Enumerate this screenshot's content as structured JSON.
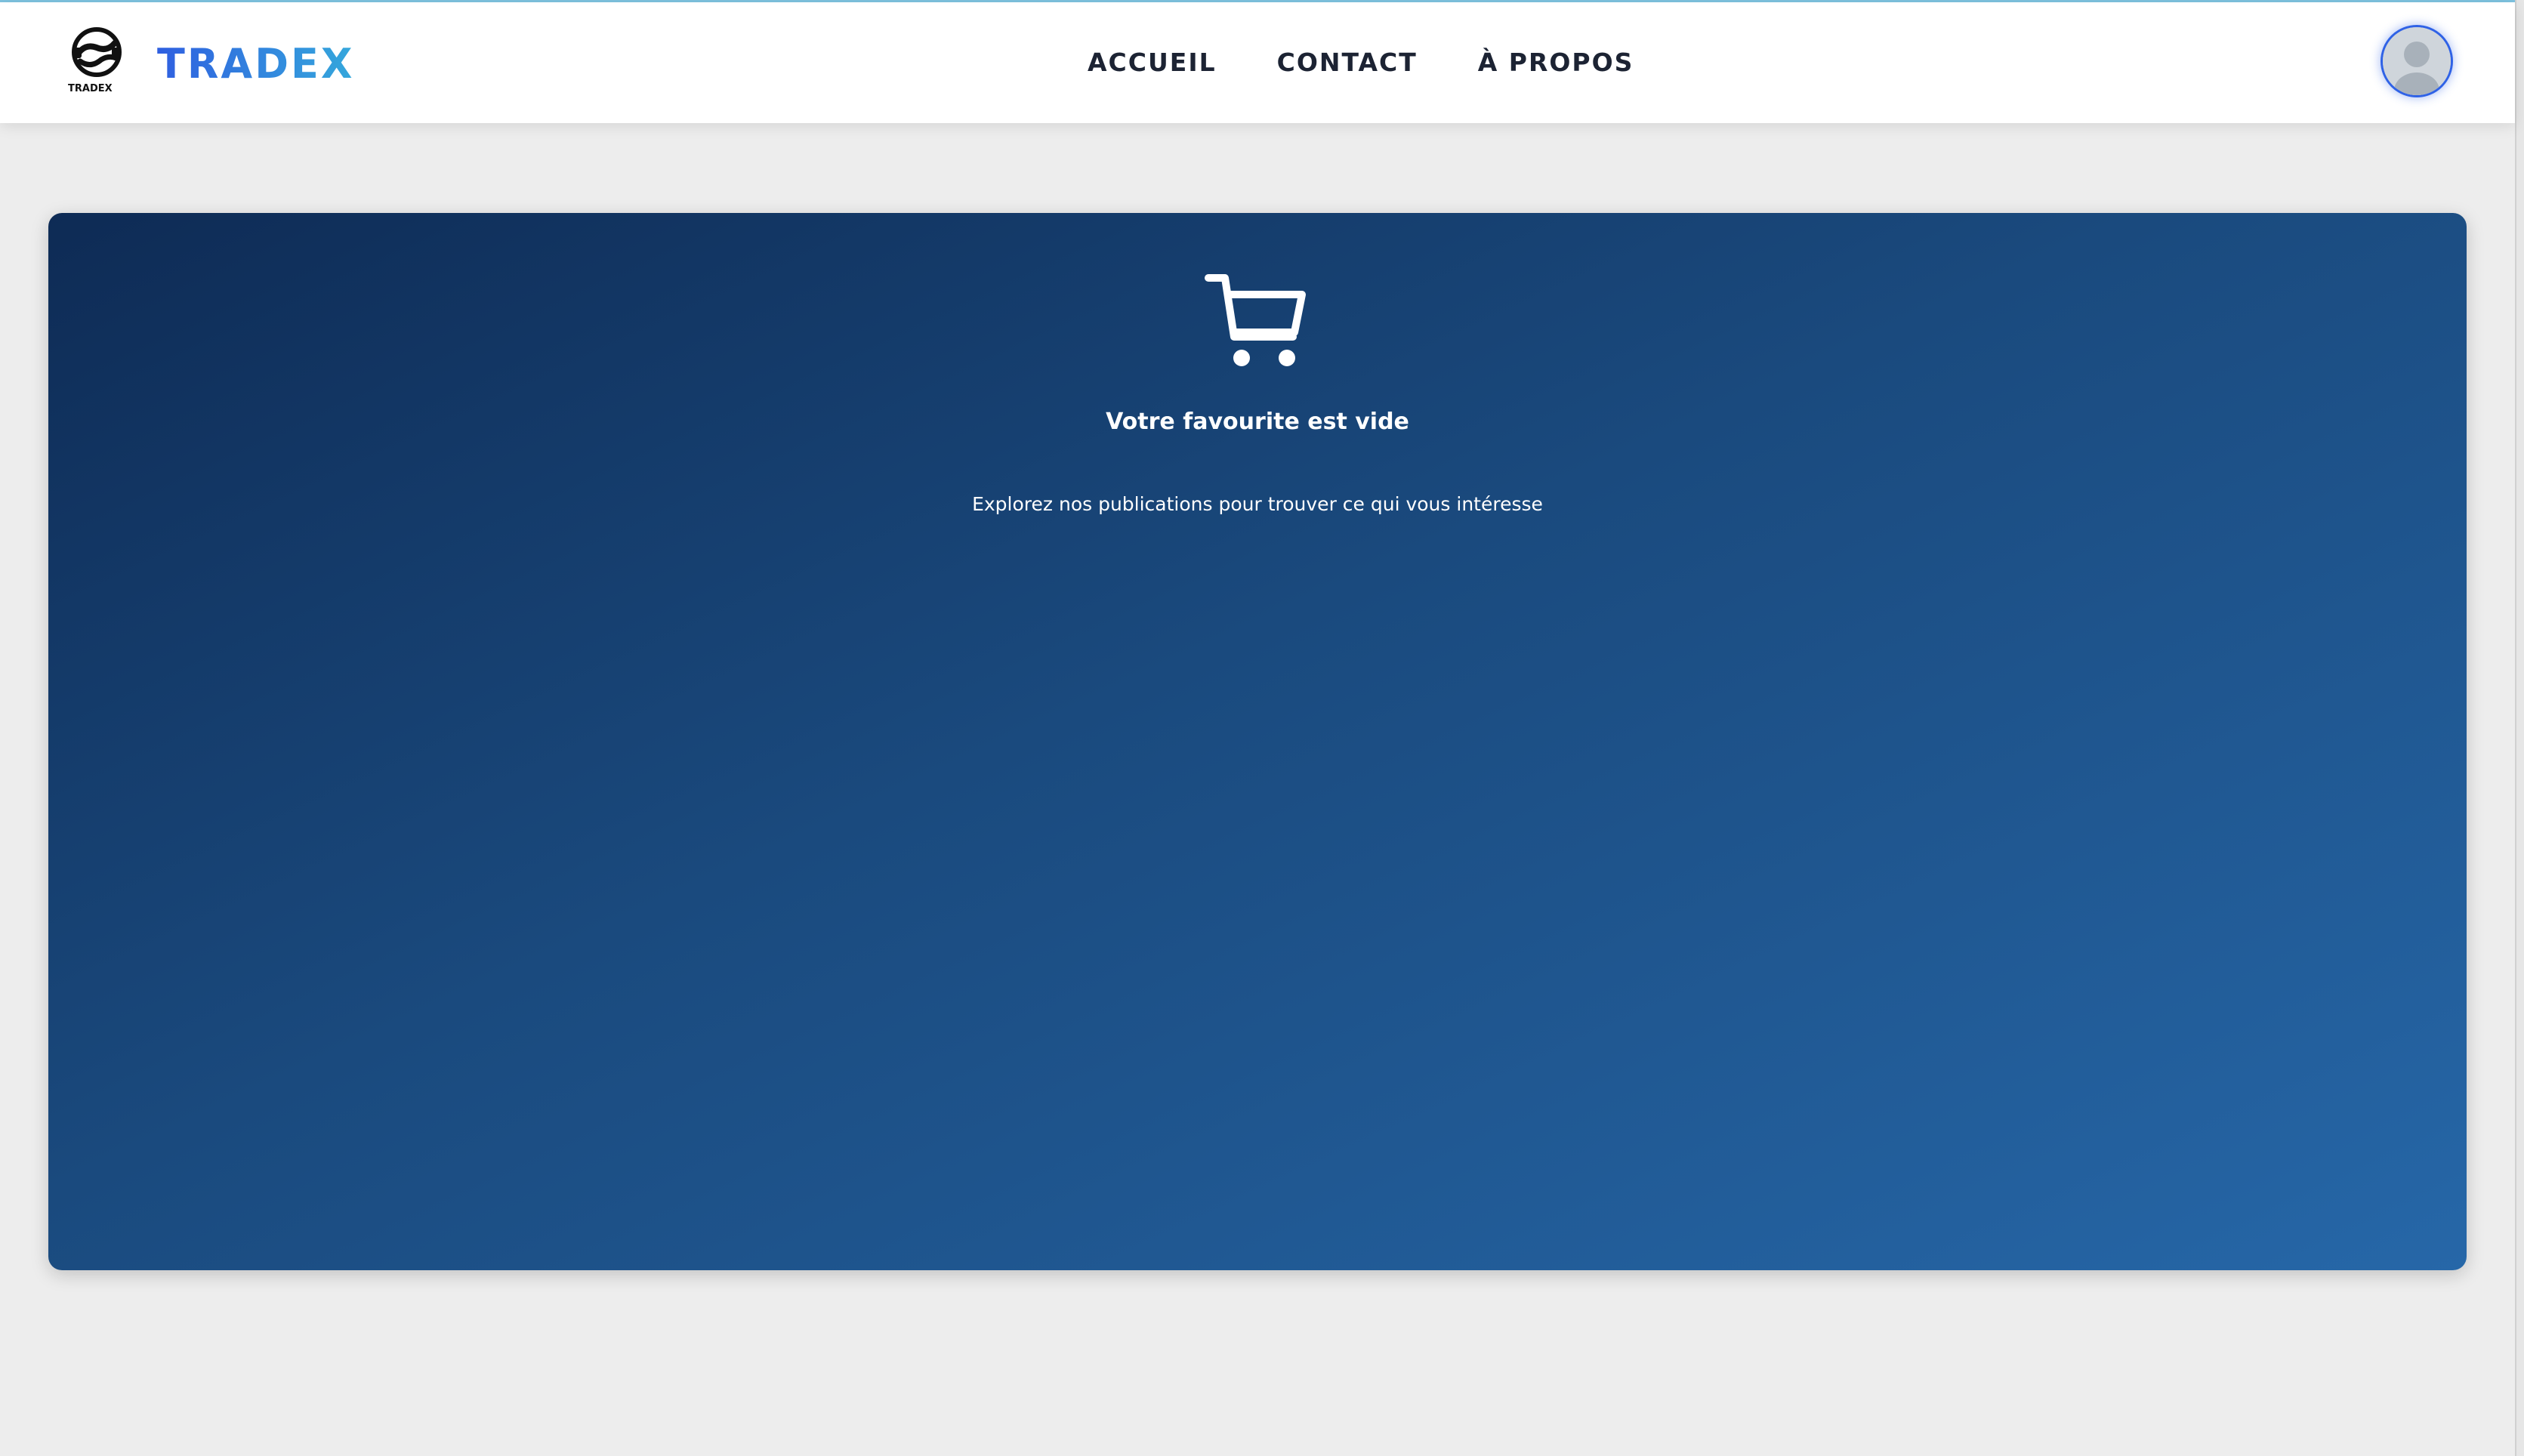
{
  "header": {
    "brand_name": "TRADEX",
    "logo_caption": "TRADEX",
    "nav": [
      {
        "label": "ACCUEIL"
      },
      {
        "label": "CONTACT"
      },
      {
        "label": "À PROPOS"
      }
    ],
    "avatar_icon": "user-avatar-icon"
  },
  "empty_state": {
    "icon": "cart-icon",
    "title": "Votre favourite est vide",
    "subtitle": "Explorez nos publications pour trouver ce qui vous intéresse"
  },
  "colors": {
    "brand_gradient_start": "#2f5fe0",
    "brand_gradient_end": "#35a8dc",
    "card_gradient_start": "#0e2b55",
    "card_gradient_end": "#2667a8",
    "avatar_ring": "#2f62e6",
    "page_background": "#ededed",
    "nav_text": "#1c2333"
  }
}
